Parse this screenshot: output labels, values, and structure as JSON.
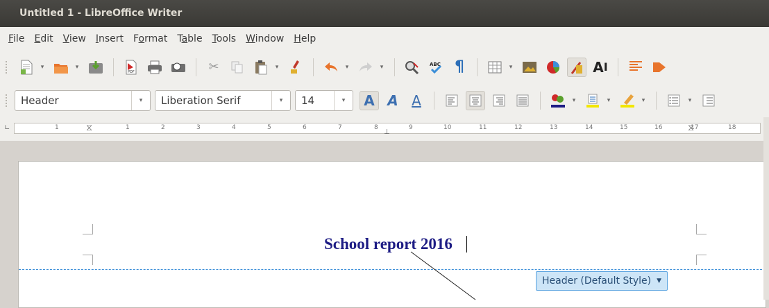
{
  "window": {
    "title": "Untitled 1 - LibreOffice Writer"
  },
  "menu": [
    {
      "acc": "F",
      "rest": "ile"
    },
    {
      "acc": "E",
      "rest": "dit"
    },
    {
      "acc": "V",
      "rest": "iew"
    },
    {
      "acc": "I",
      "rest": "nsert"
    },
    {
      "pre": "F",
      "acc": "o",
      "rest": "rmat"
    },
    {
      "pre": "T",
      "acc": "a",
      "rest": "ble"
    },
    {
      "acc": "T",
      "rest": "ools"
    },
    {
      "acc": "W",
      "rest": "indow"
    },
    {
      "acc": "H",
      "rest": "elp"
    }
  ],
  "formatting": {
    "paragraph_style": "Header",
    "font_name": "Liberation Serif",
    "font_size": "14"
  },
  "ruler": {
    "labels": [
      "1",
      "1",
      "2",
      "3",
      "4",
      "5",
      "6",
      "7",
      "8",
      "9",
      "10",
      "11",
      "12",
      "13",
      "14",
      "15",
      "16",
      "17",
      "18"
    ]
  },
  "document": {
    "header_text": "School report 2016",
    "header_tag": "Header (Default Style)"
  },
  "colors": {
    "title_bar": "#3c3b37",
    "header_text": "#1d1c84",
    "header_tag_bg": "#cde5f7"
  }
}
